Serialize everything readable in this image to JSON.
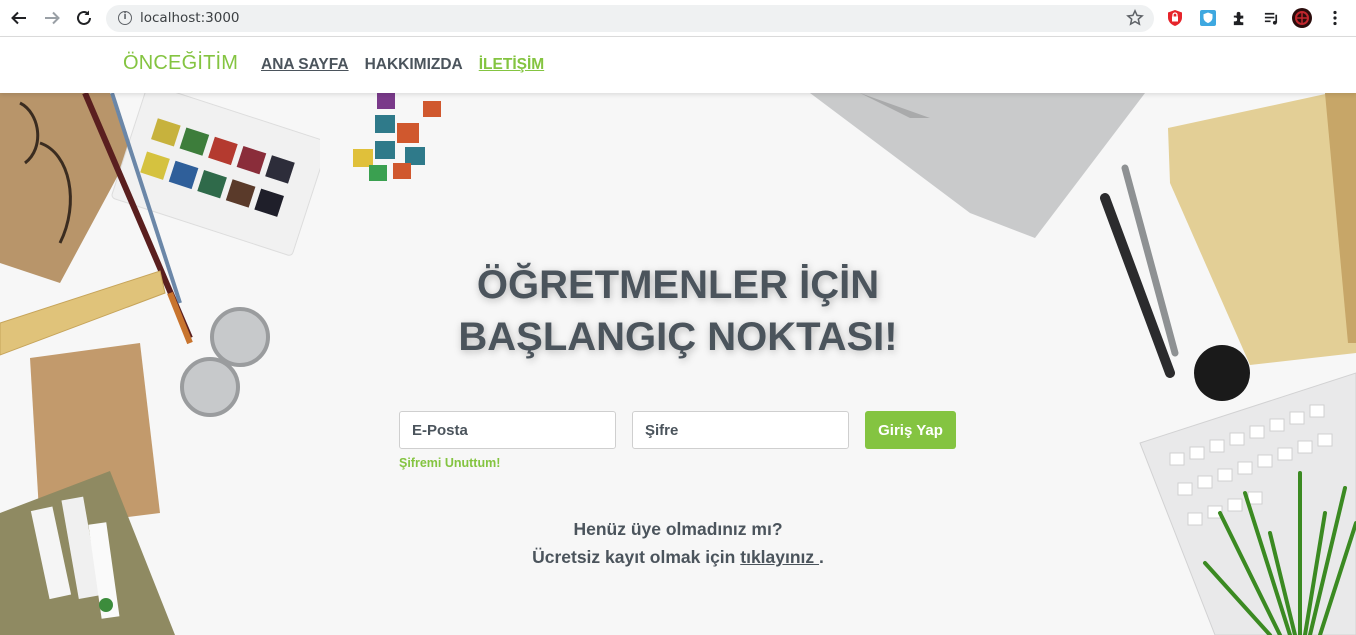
{
  "browser": {
    "url": "localhost:3000",
    "icons": [
      "back-icon",
      "forward-icon",
      "reload-icon",
      "site-info-icon",
      "bookmark-star-icon",
      "shield-extension-icon",
      "blue-shield-extension-icon",
      "puzzle-extensions-icon",
      "media-control-icon",
      "profile-avatar-icon",
      "more-menu-icon"
    ]
  },
  "header": {
    "brand": "ÖNCEĞİTİM",
    "menu": [
      {
        "label": "ANA SAYFA"
      },
      {
        "label": "HAKKIMIZDA"
      },
      {
        "label": "İLETİŞİM"
      }
    ]
  },
  "hero": {
    "title_line1": "ÖĞRETMENLER İÇİN",
    "title_line2": "BAŞLANGIÇ NOKTASI!",
    "email_placeholder": "E-Posta",
    "password_placeholder": "Şifre",
    "login_label": "Giriş Yap",
    "forgot_label": "Şifremi Unuttum!",
    "signup_line1": "Henüz üye olmadınız mı?",
    "signup_line2_prefix": "Ücretsiz kayıt olmak için",
    "signup_link": "tıklayınız ",
    "signup_suffix": "."
  },
  "colors": {
    "accent": "#84c441",
    "text": "#4b545c",
    "background": "#f7f7f7"
  }
}
